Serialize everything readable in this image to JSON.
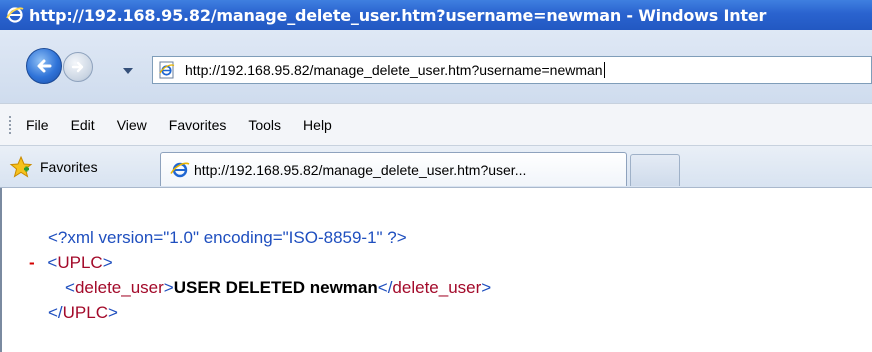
{
  "window": {
    "title": "http://192.168.95.82/manage_delete_user.htm?username=newman - Windows Inter"
  },
  "address_bar": {
    "url": "http://192.168.95.82/manage_delete_user.htm?username=newman"
  },
  "menu": {
    "items": [
      "File",
      "Edit",
      "View",
      "Favorites",
      "Tools",
      "Help"
    ]
  },
  "favorites_bar": {
    "favorites_label": "Favorites",
    "active_tab_label": "http://192.168.95.82/manage_delete_user.htm?user..."
  },
  "content": {
    "xml_declaration": "<?xml version=\"1.0\" encoding=\"ISO-8859-1\" ?>",
    "collapse_marker": "-",
    "root_open_lt": "<",
    "root_open_name": "UPLC",
    "root_open_gt": ">",
    "child_open_lt": "<",
    "child_open_name": "delete_user",
    "child_open_gt": ">",
    "child_text": "USER DELETED newman",
    "child_close_lt": "</",
    "child_close_name": "delete_user",
    "child_close_gt": ">",
    "root_close_lt": "</",
    "root_close_name": "UPLC",
    "root_close_gt": ">"
  },
  "colors": {
    "titlebar": "#2a63cf",
    "xml_declaration": "#1f4fbf",
    "xml_tag_name": "#a30a2a",
    "collapse_marker": "#d40000"
  }
}
